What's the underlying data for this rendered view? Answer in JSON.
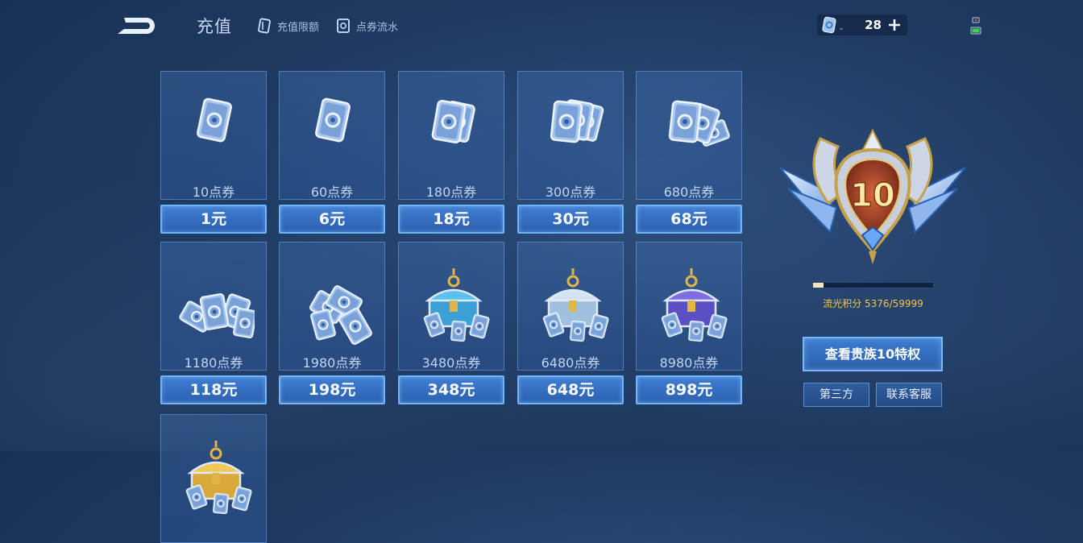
{
  "header": {
    "title": "充值",
    "links": [
      {
        "label": "充值限额",
        "icon": "card-icon"
      },
      {
        "label": "点券流水",
        "icon": "ticket-log-icon"
      }
    ]
  },
  "currency": {
    "icon": "voucher-icon",
    "amount": "28"
  },
  "products": [
    {
      "name": "10点券",
      "price": "1元",
      "art": "single-voucher"
    },
    {
      "name": "60点券",
      "price": "6元",
      "art": "single-voucher"
    },
    {
      "name": "180点券",
      "price": "18元",
      "art": "two-vouchers"
    },
    {
      "name": "300点券",
      "price": "30元",
      "art": "three-vouchers"
    },
    {
      "name": "680点券",
      "price": "68元",
      "art": "voucher-fan"
    },
    {
      "name": "1180点券",
      "price": "118元",
      "art": "voucher-spread"
    },
    {
      "name": "1980点券",
      "price": "198元",
      "art": "voucher-stacks"
    },
    {
      "name": "3480点券",
      "price": "348元",
      "art": "blue-chest"
    },
    {
      "name": "6480点券",
      "price": "648元",
      "art": "silver-chest"
    },
    {
      "name": "8980点券",
      "price": "898元",
      "art": "purple-chest"
    },
    {
      "name": "",
      "price": "",
      "art": "gold-chest"
    }
  ],
  "noble": {
    "level": "10",
    "points_label": "流光积分",
    "points_value": "5376/59999",
    "progress": 0.09,
    "view_button": "查看贵族10特权"
  },
  "footer_buttons": {
    "third_party": "第三方",
    "service": "联系客服"
  },
  "colors": {
    "accent": "#6fb4ff",
    "gold": "#f3c851",
    "price_bg": "#2c60b0"
  }
}
